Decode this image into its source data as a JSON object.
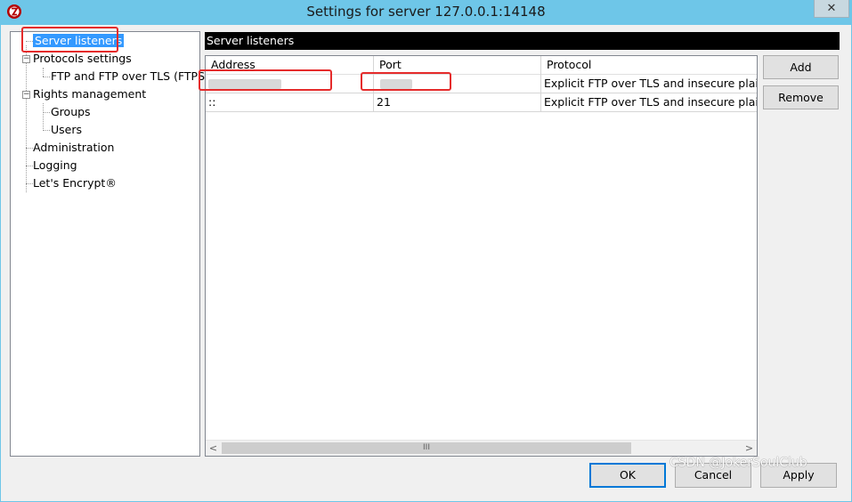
{
  "window": {
    "title": "Settings for server 127.0.0.1:14148",
    "close_label": "✕"
  },
  "tree": {
    "items": [
      {
        "label": "Server listeners"
      },
      {
        "label": "Protocols settings"
      },
      {
        "label": "FTP and FTP over TLS (FTPS)"
      },
      {
        "label": "Rights management"
      },
      {
        "label": "Groups"
      },
      {
        "label": "Users"
      },
      {
        "label": "Administration"
      },
      {
        "label": "Logging"
      },
      {
        "label": "Let's Encrypt®"
      }
    ],
    "expander_minus": "−"
  },
  "panel": {
    "title": "Server listeners"
  },
  "listview": {
    "columns": [
      "Address",
      "Port",
      "Protocol"
    ],
    "rows": [
      {
        "address": "",
        "port": "",
        "protocol": "Explicit FTP over TLS and insecure plain FTP"
      },
      {
        "address": "::",
        "port": "21",
        "protocol": "Explicit FTP over TLS and insecure plain FTP"
      }
    ],
    "scroll_left": "<",
    "scroll_right": ">",
    "scroll_grip": "III"
  },
  "side_buttons": {
    "add": "Add",
    "remove": "Remove"
  },
  "footer_buttons": {
    "ok": "OK",
    "cancel": "Cancel",
    "apply": "Apply"
  },
  "watermark": "CSDN @JokerSoulClub",
  "colors": {
    "titlebar": "#6ec6e8",
    "selection": "#3399ff",
    "highlight": "#e52b2b"
  }
}
